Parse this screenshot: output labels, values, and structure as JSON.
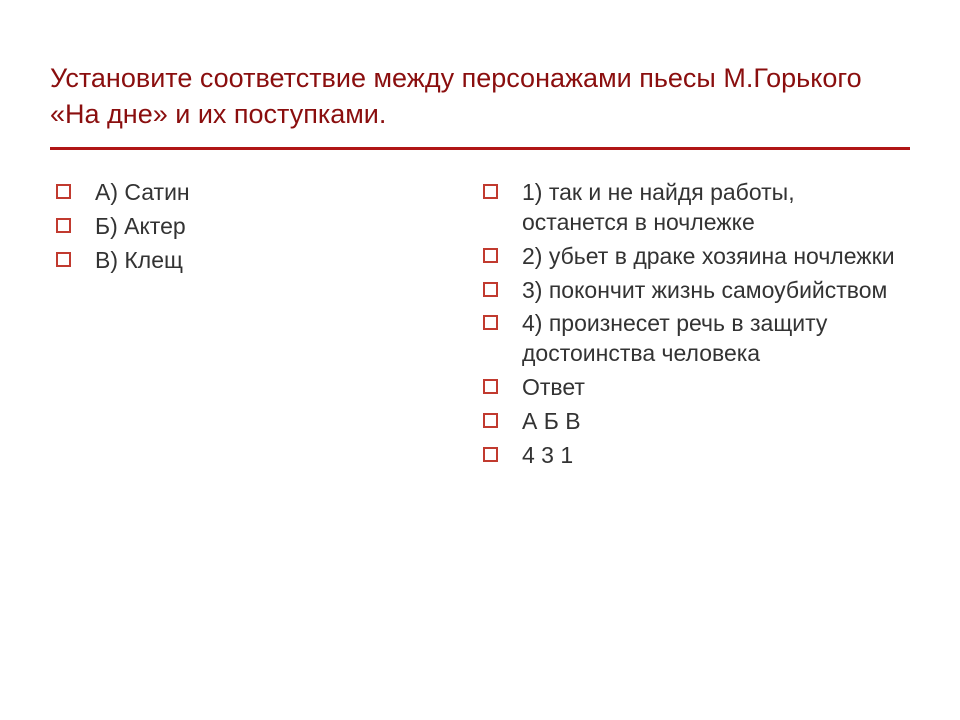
{
  "title": "Установите соответствие между персонажами пьесы М.Горького «На дне» и их поступками.",
  "left": {
    "items": [
      "А) Сатин",
      "Б) Актер",
      "В) Клещ"
    ]
  },
  "right": {
    "items": [
      "1) так и не  найдя работы, останется в ночлежке",
      "2) убьет в драке хозяина ночлежки",
      "3) покончит жизнь самоубийством",
      "4) произнесет речь в защиту достоинства человека",
      "Ответ",
      "А   Б   В",
      "4   3   1"
    ]
  }
}
